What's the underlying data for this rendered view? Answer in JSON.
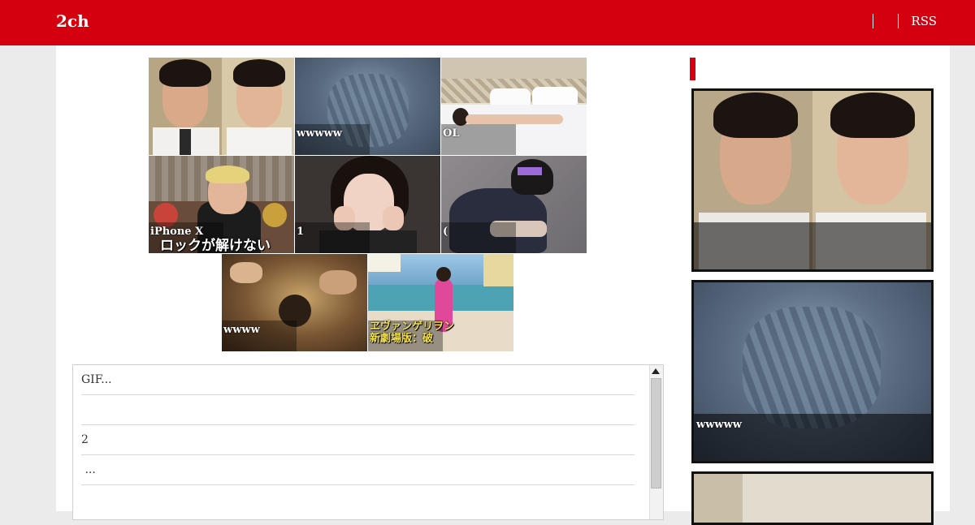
{
  "site": {
    "logo": "2ch",
    "nav_rss": "RSS"
  },
  "thumbnails": [
    {
      "caption": ""
    },
    {
      "caption": "wwwww"
    },
    {
      "caption": "OL"
    },
    {
      "caption": "iPhone X",
      "overlay_text": "ロックが解けない"
    },
    {
      "caption": "1"
    },
    {
      "caption": "("
    },
    {
      "caption": "wwww"
    },
    {
      "caption": "",
      "overlay_text": "ヱヴァンゲリヲン\n新劇場版：破"
    }
  ],
  "comments": [
    {
      "text": "GIF..."
    },
    {
      "text": ""
    },
    {
      "text": "2"
    },
    {
      "text": " ..."
    },
    {
      "text": ""
    }
  ],
  "sidebar": {
    "cards": [
      {
        "caption": ""
      },
      {
        "caption": "wwwww"
      },
      {
        "caption": ""
      }
    ]
  },
  "colors": {
    "brand": "#d4000f",
    "background": "#ebebeb",
    "panel": "#ffffff"
  }
}
